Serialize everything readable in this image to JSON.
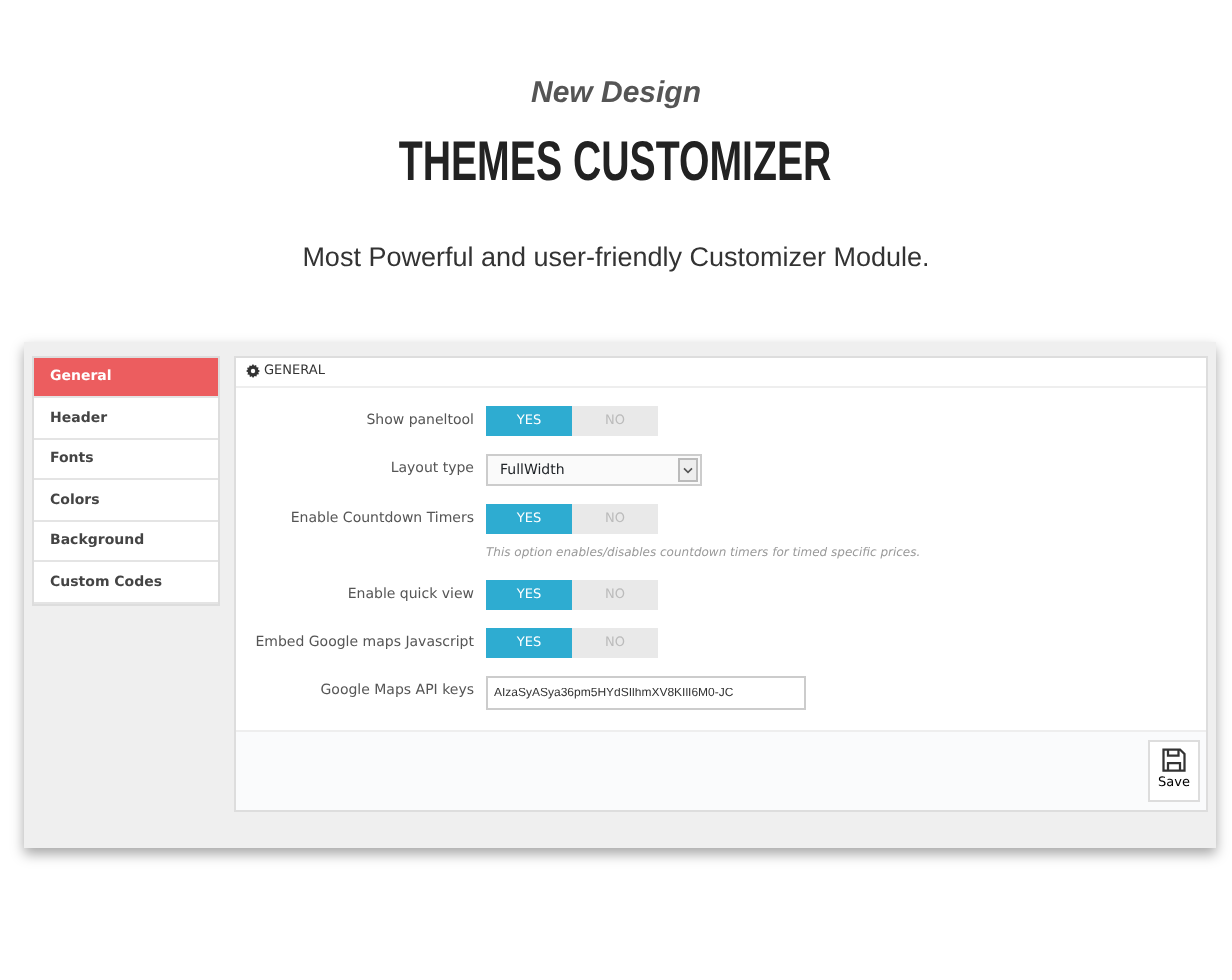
{
  "hero": {
    "eyebrow": "New Design",
    "title": "THEMES CUSTOMIZER",
    "tagline": "Most Powerful and user-friendly Customizer Module."
  },
  "sidebar": {
    "items": [
      {
        "label": "General",
        "selected": true
      },
      {
        "label": "Header",
        "selected": false
      },
      {
        "label": "Fonts",
        "selected": false
      },
      {
        "label": "Colors",
        "selected": false
      },
      {
        "label": "Background",
        "selected": false
      },
      {
        "label": "Custom Codes",
        "selected": false
      }
    ]
  },
  "panel": {
    "title": "GENERAL",
    "settings": [
      {
        "kind": "toggle",
        "label": "Show paneltool",
        "yes": "YES",
        "no": "NO",
        "on": true
      },
      {
        "kind": "select",
        "label": "Layout type",
        "value": "FullWidth"
      },
      {
        "kind": "toggle",
        "label": "Enable Countdown Timers",
        "yes": "YES",
        "no": "NO",
        "on": true,
        "help": "This option enables/disables countdown timers for timed specific prices."
      },
      {
        "kind": "toggle",
        "label": "Enable quick view",
        "yes": "YES",
        "no": "NO",
        "on": true
      },
      {
        "kind": "toggle",
        "label": "Embed Google maps Javascript",
        "yes": "YES",
        "no": "NO",
        "on": true
      },
      {
        "kind": "input",
        "label": "Google Maps API keys",
        "value": "AIzaSyASya36pm5HYdSIlhmXV8KIlI6M0-JC"
      }
    ],
    "save": "Save"
  }
}
